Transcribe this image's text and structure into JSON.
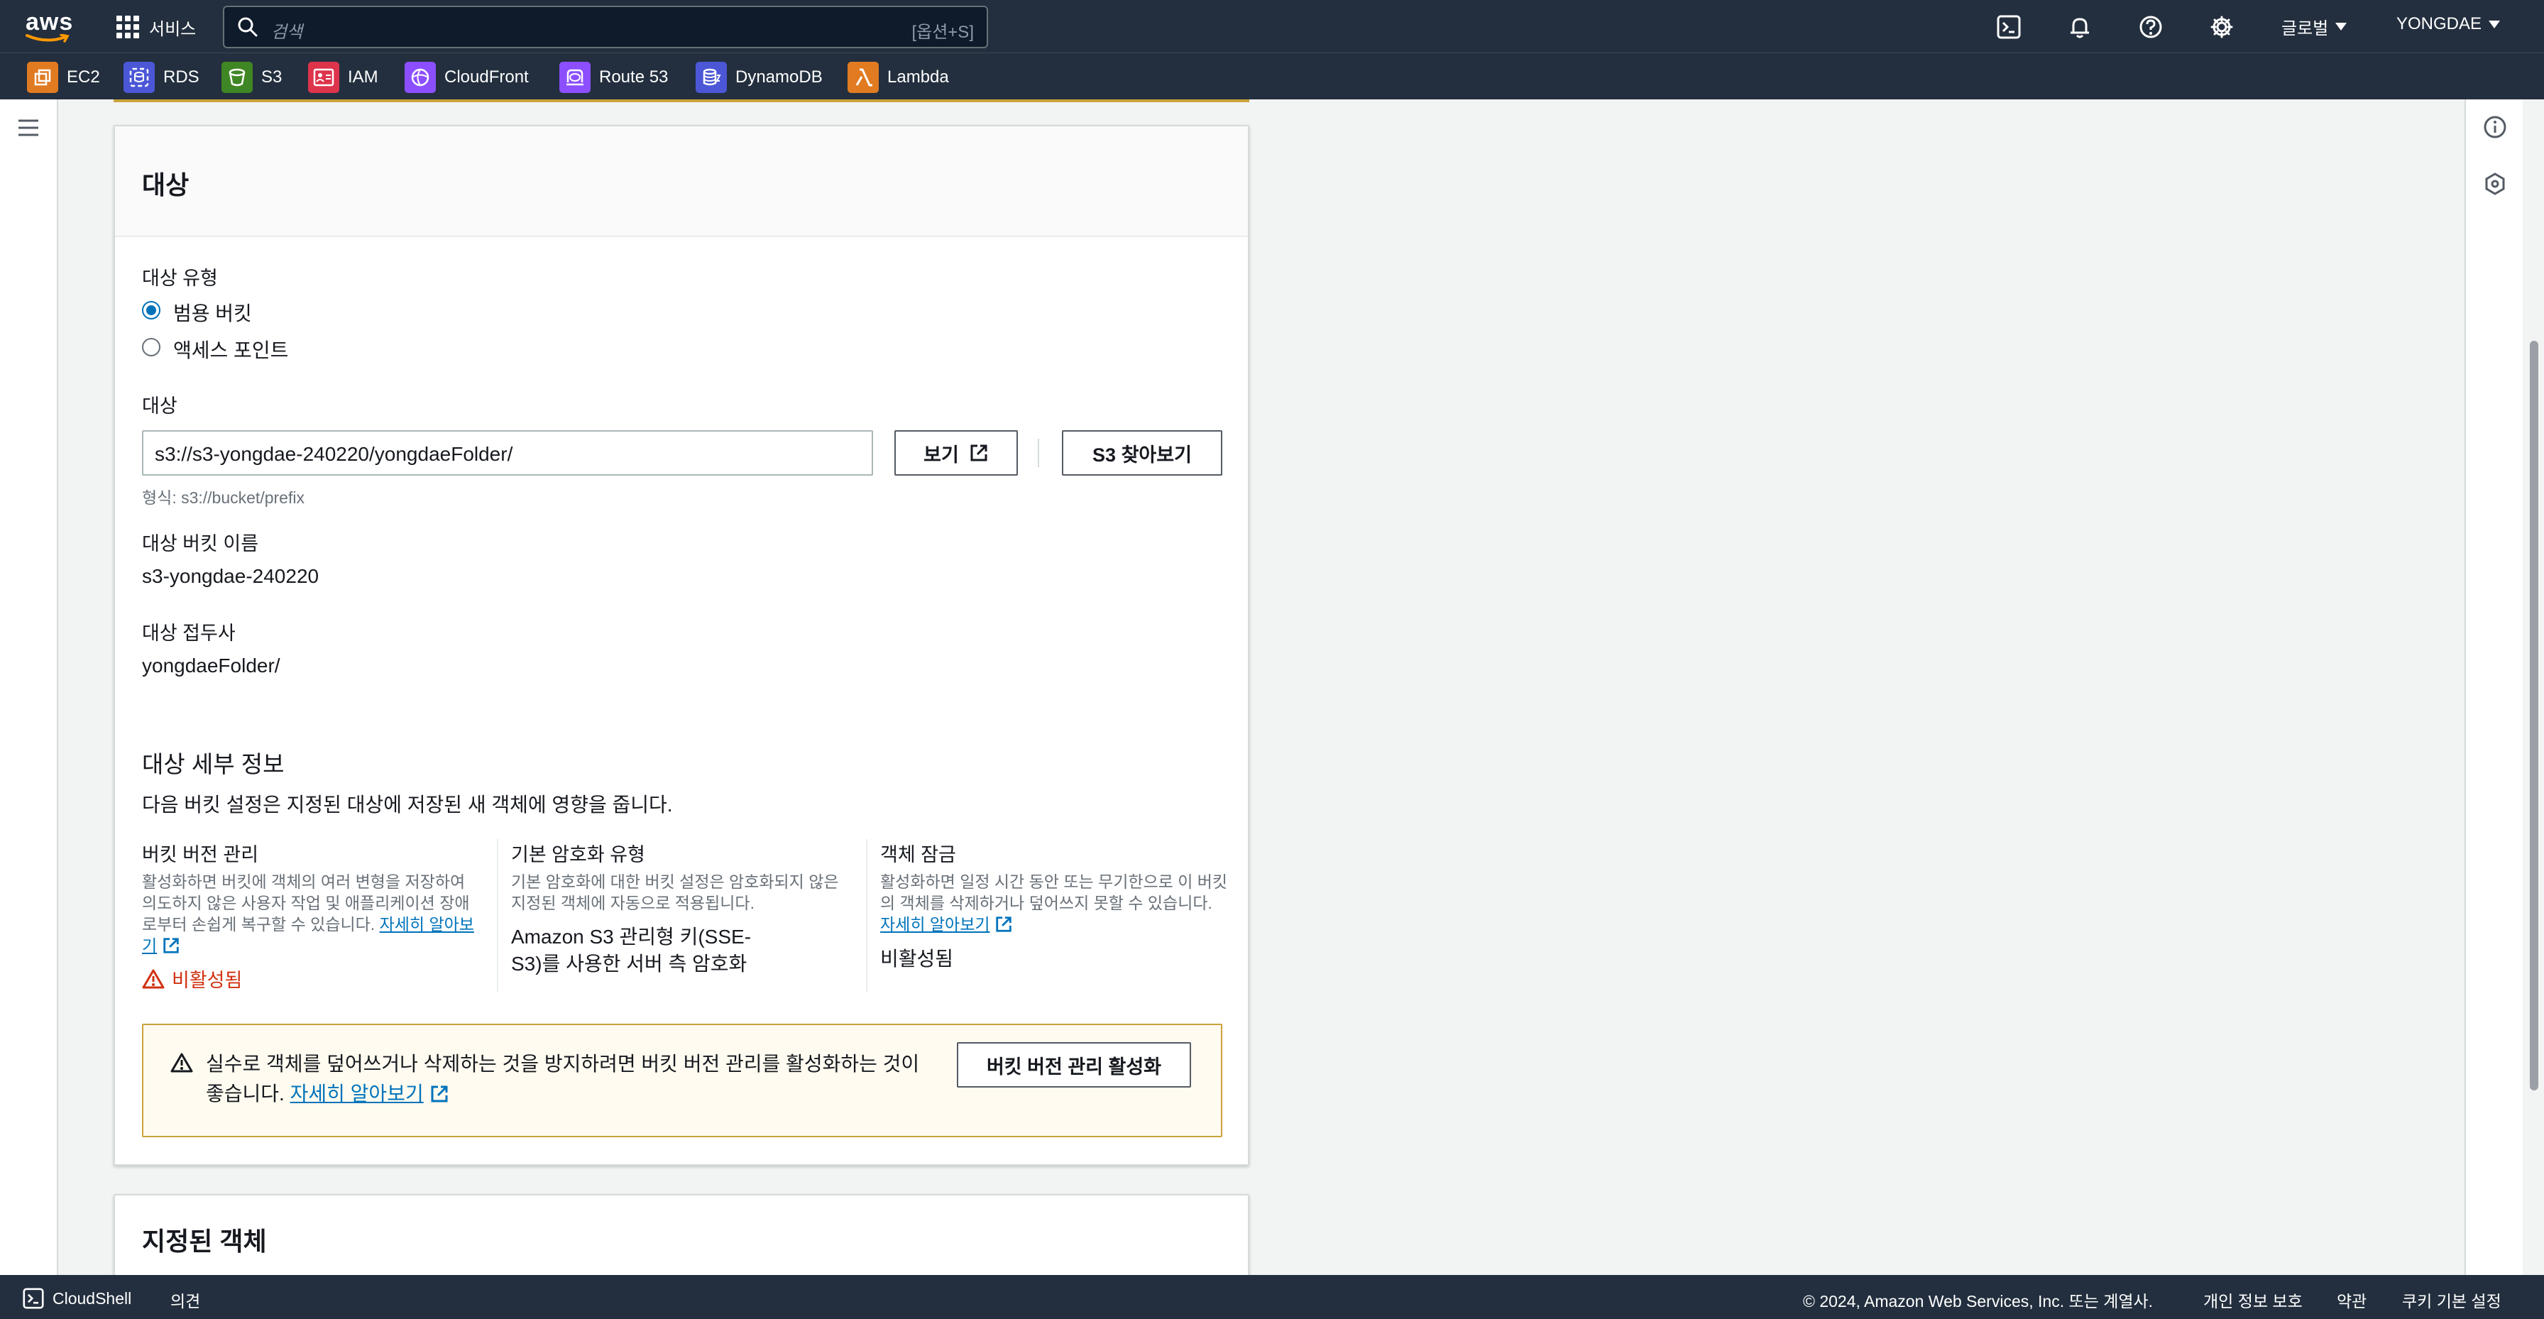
{
  "topnav": {
    "logo_text": "aws",
    "services_label": "서비스",
    "search_placeholder": "검색",
    "search_shortcut": "[옵션+S]",
    "region_label": "글로벌",
    "user_label": "YONGDAE"
  },
  "favorites": [
    {
      "label": "EC2",
      "color": "#e07b22",
      "icon": "ec2-icon"
    },
    {
      "label": "RDS",
      "color": "#4b57d6",
      "icon": "rds-icon"
    },
    {
      "label": "S3",
      "color": "#3f8624",
      "icon": "s3-icon"
    },
    {
      "label": "IAM",
      "color": "#dd344c",
      "icon": "iam-icon"
    },
    {
      "label": "CloudFront",
      "color": "#8c4fff",
      "icon": "cloudfront-icon"
    },
    {
      "label": "Route 53",
      "color": "#8c4fff",
      "icon": "route53-icon"
    },
    {
      "label": "DynamoDB",
      "color": "#4b57d6",
      "icon": "dynamodb-icon"
    },
    {
      "label": "Lambda",
      "color": "#e07b22",
      "icon": "lambda-icon"
    }
  ],
  "destination": {
    "title": "대상",
    "type_label": "대상 유형",
    "type_options": [
      "범용 버킷",
      "액세스 포인트"
    ],
    "selected_type": "범용 버킷",
    "dest_label": "대상",
    "dest_value": "s3://s3-yongdae-240220/yongdaeFolder/",
    "view_button": "보기",
    "browse_button": "S3 찾아보기",
    "format_hint": "형식: s3://bucket/prefix",
    "bucket_name_label": "대상 버킷 이름",
    "bucket_name_value": "s3-yongdae-240220",
    "prefix_label": "대상 접두사",
    "prefix_value": "yongdaeFolder/",
    "details_title": "대상 세부 정보",
    "details_desc": "다음 버킷 설정은 지정된 대상에 저장된 새 객체에 영향을 줍니다.",
    "versioning": {
      "title": "버킷 버전 관리",
      "desc": "활성화하면 버킷에 객체의 여러 변형을 저장하여 의도하지 않은 사용자 작업 및 애플리케이션 장애로부터 손쉽게 복구할 수 있습니다.",
      "learn_more": "자세히 알아보기",
      "status": "비활성됨"
    },
    "encryption": {
      "title": "기본 암호화 유형",
      "desc": "기본 암호화에 대한 버킷 설정은 암호화되지 않은 지정된 객체에 자동으로 적용됩니다.",
      "value": "Amazon S3 관리형 키(SSE-S3)를 사용한 서버 측 암호화"
    },
    "object_lock": {
      "title": "객체 잠금",
      "desc": "활성화하면 일정 시간 동안 또는 무기한으로 이 버킷의 객체를 삭제하거나 덮어쓰지 못할 수 있습니다.",
      "learn_more": "자세히 알아보기",
      "status": "비활성됨"
    },
    "alert": {
      "text": "실수로 객체를 덮어쓰거나 삭제하는 것을 방지하려면 버킷 버전 관리를 활성화하는 것이 좋습니다.",
      "learn_more": "자세히 알아보기",
      "button": "버킷 버전 관리 활성화"
    }
  },
  "specified_objects": {
    "title": "지정된 객체"
  },
  "footer": {
    "cloudshell": "CloudShell",
    "feedback": "의견",
    "copyright": "© 2024, Amazon Web Services, Inc. 또는 계열사.",
    "privacy": "개인 정보 보호",
    "terms": "약관",
    "cookies": "쿠키 기본 설정"
  }
}
